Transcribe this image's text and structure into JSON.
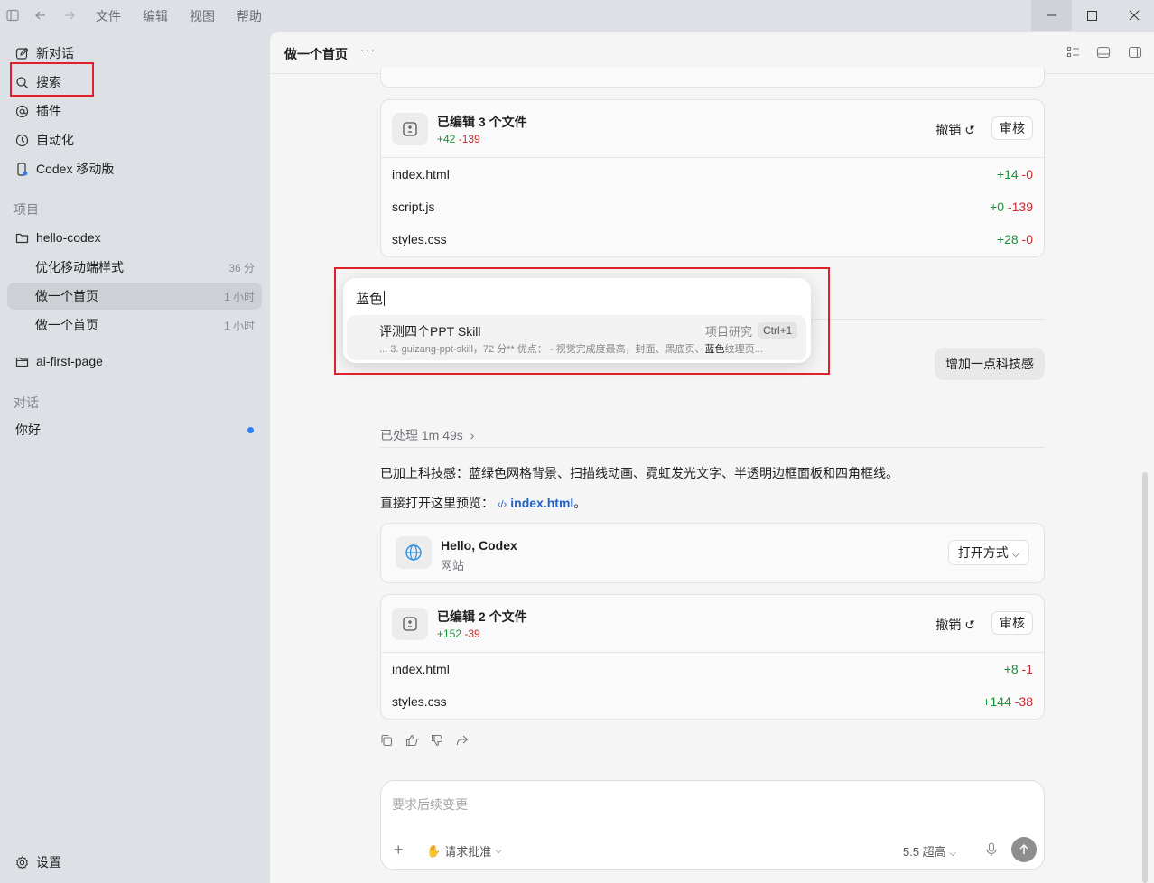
{
  "titlebar": {
    "menus": [
      "文件",
      "编辑",
      "视图",
      "帮助"
    ]
  },
  "sidebar": {
    "top_items": [
      {
        "label": "新对话",
        "icon": "new-chat-icon"
      },
      {
        "label": "搜索",
        "icon": "search-icon"
      },
      {
        "label": "插件",
        "icon": "plugin-icon"
      },
      {
        "label": "自动化",
        "icon": "clock-icon"
      },
      {
        "label": "Codex 移动版",
        "icon": "mobile-icon"
      }
    ],
    "projects_label": "项目",
    "projects": [
      {
        "name": "hello-codex",
        "threads": [
          {
            "title": "优化移动端样式",
            "time": "36 分"
          },
          {
            "title": "做一个首页",
            "time": "1 小时",
            "active": true
          },
          {
            "title": "做一个首页",
            "time": "1 小时"
          }
        ]
      },
      {
        "name": "ai-first-page",
        "threads": []
      }
    ],
    "chats_label": "对话",
    "chats": [
      {
        "title": "你好",
        "unread": true
      }
    ],
    "settings_label": "设置"
  },
  "header": {
    "title": "做一个首页",
    "more": "···"
  },
  "card1": {
    "title": "已编辑 3 个文件",
    "added": "+42",
    "removed": "-139",
    "undo": "撤销",
    "review": "审核",
    "files": [
      {
        "name": "index.html",
        "added": "+14",
        "removed": "-0"
      },
      {
        "name": "script.js",
        "added": "+0",
        "removed": "-139"
      },
      {
        "name": "styles.css",
        "added": "+28",
        "removed": "-0"
      }
    ]
  },
  "user_chip": "增加一点科技感",
  "processed": "已处理 1m 49s",
  "reply": {
    "line1": "已加上科技感：蓝绿色网格背景、扫描线动画、霓虹发光文字、半透明边框面板和四角框线。",
    "line2_prefix": "直接打开这里预览：",
    "link": "index.html",
    "line2_suffix": "。"
  },
  "site_card": {
    "title": "Hello, Codex",
    "subtitle": "网站",
    "open_label": "打开方式"
  },
  "card2": {
    "title": "已编辑 2 个文件",
    "added": "+152",
    "removed": "-39",
    "undo": "撤销",
    "review": "审核",
    "files": [
      {
        "name": "index.html",
        "added": "+8",
        "removed": "-1"
      },
      {
        "name": "styles.css",
        "added": "+144",
        "removed": "-38"
      }
    ]
  },
  "composer": {
    "placeholder": "要求后续变更",
    "approval": "请求批准",
    "model": "5.5 超高"
  },
  "search_popup": {
    "query": "蓝色",
    "result_title": "评测四个PPT Skill",
    "result_project": "项目研究",
    "result_shortcut": "Ctrl+1",
    "snippet_before": "... 3. guizang-ppt-skill，72 分** 优点： - 视觉完成度最高，封面、黑底页、",
    "snippet_highlight": "蓝色",
    "snippet_after": "纹理页..."
  },
  "colors": {
    "added": "#1a8f3a",
    "removed": "#c8282e",
    "link": "#2263c4",
    "highlight_box": "#e0202a",
    "unread_dot": "#2f7ff0"
  }
}
